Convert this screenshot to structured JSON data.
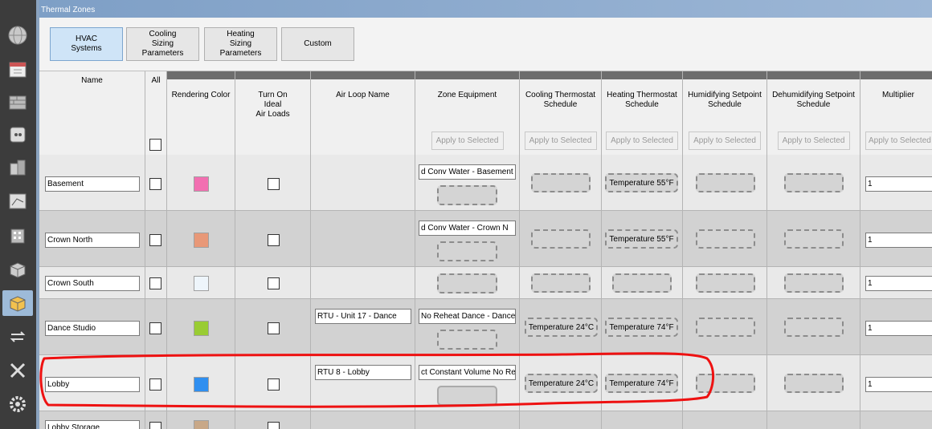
{
  "window": {
    "title": "Thermal Zones"
  },
  "sidebar": {
    "items": [
      {
        "icon": "globe-icon"
      },
      {
        "icon": "calendar-icon"
      },
      {
        "icon": "bricks-icon"
      },
      {
        "icon": "outlet-icon"
      },
      {
        "icon": "building-blocks-icon"
      },
      {
        "icon": "floorplan-icon"
      },
      {
        "icon": "building-icon"
      },
      {
        "icon": "box-icon"
      },
      {
        "icon": "thermal-zones-icon"
      },
      {
        "icon": "loop-arrows-icon"
      },
      {
        "icon": "tools-icon"
      },
      {
        "icon": "gear-icon"
      }
    ]
  },
  "toolbar": {
    "tabs": [
      {
        "label": "HVAC\nSystems"
      },
      {
        "label": "Cooling\nSizing\nParameters"
      },
      {
        "label": "Heating\nSizing\nParameters"
      },
      {
        "label": "Custom"
      }
    ]
  },
  "table": {
    "headers": {
      "name": "Name",
      "all": "All",
      "color": "Rendering Color",
      "ideal": "Turn On\nIdeal\nAir Loads",
      "airloop": "Air Loop Name",
      "equip": "Zone Equipment",
      "cool": "Cooling Thermostat\nSchedule",
      "heat": "Heating Thermostat\nSchedule",
      "humid": "Humidifying Setpoint\nSchedule",
      "dehumid": "Dehumidifying Setpoint\nSchedule",
      "mult": "Multiplier"
    },
    "apply_label": "Apply to Selected",
    "rows": [
      {
        "name": "Basement",
        "color": "#f26fb1",
        "airloop": "",
        "equipment": "d Conv Water - Basement",
        "cool": "",
        "heat": "Temperature 55°F",
        "multiplier": "1"
      },
      {
        "name": "Crown North",
        "color": "#e89878",
        "airloop": "",
        "equipment": "d Conv Water - Crown N",
        "cool": "",
        "heat": "Temperature 55°F",
        "multiplier": "1"
      },
      {
        "name": "Crown South",
        "color": "#eef5fb",
        "airloop": "",
        "equipment": "",
        "cool": "",
        "heat": "",
        "multiplier": "1"
      },
      {
        "name": "Dance Studio",
        "color": "#99cc33",
        "airloop": "RTU - Unit 17 - Dance",
        "equipment": "No Reheat Dance - Dance",
        "cool": "Temperature 24°C",
        "heat": "Temperature 74°F",
        "multiplier": "1"
      },
      {
        "name": "Lobby",
        "color": "#2f8ff0",
        "airloop": "RTU 8 - Lobby",
        "equipment": "ct Constant Volume No Reh",
        "cool": "Temperature 24°C",
        "heat": "Temperature 74°F",
        "multiplier": "1"
      },
      {
        "name": "Lobby Storage",
        "color": "#c8a888",
        "airloop": "",
        "equipment": "",
        "cool": "",
        "heat": "",
        "multiplier": ""
      }
    ]
  },
  "annotation": {
    "color": "#ee1111"
  }
}
